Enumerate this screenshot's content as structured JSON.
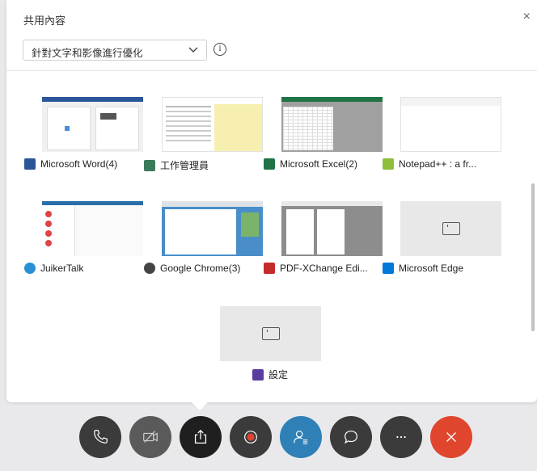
{
  "header": {
    "title": "共用內容",
    "close_glyph": "×",
    "optimize_select_value": "針對文字和影像進行優化",
    "info_glyph": "i"
  },
  "colors": {
    "toolbar_dark": "#3b3b3b",
    "share_active": "#1f1f1f",
    "contacts_blue": "#2f80b6",
    "end_call_red": "#e0452e",
    "word_blue": "#2b579a",
    "excel_green": "#217346",
    "edge_blue": "#0078d7",
    "settings_purple": "#5a3c9e",
    "pdf_red": "#c62b2b"
  },
  "apps": [
    {
      "label": "Microsoft Word(4)",
      "icon": "word-icon"
    },
    {
      "label": "工作管理員",
      "icon": "task-manager-icon"
    },
    {
      "label": "Microsoft Excel(2)",
      "icon": "excel-icon"
    },
    {
      "label": "Notepad++ : a fr...",
      "icon": "notepadpp-icon"
    },
    {
      "label": "JuikerTalk",
      "icon": "juikertalk-icon"
    },
    {
      "label": "Google Chrome(3)",
      "icon": "chrome-icon"
    },
    {
      "label": "PDF-XChange Edi...",
      "icon": "pdfxchange-icon"
    },
    {
      "label": "Microsoft Edge",
      "icon": "edge-icon"
    },
    {
      "label": "設定",
      "icon": "settings-icon"
    }
  ],
  "toolbar": [
    {
      "name": "phone-button",
      "icon": "phone-icon"
    },
    {
      "name": "video-off-button",
      "icon": "video-off-icon"
    },
    {
      "name": "share-content-button",
      "icon": "share-icon"
    },
    {
      "name": "record-button",
      "icon": "record-icon"
    },
    {
      "name": "participants-button",
      "icon": "participants-icon"
    },
    {
      "name": "chat-button",
      "icon": "chat-icon"
    },
    {
      "name": "more-button",
      "icon": "more-icon"
    },
    {
      "name": "end-call-button",
      "icon": "end-call-icon"
    }
  ]
}
